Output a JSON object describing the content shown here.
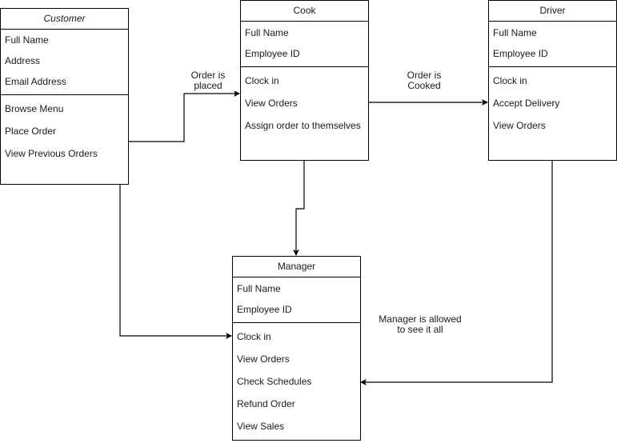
{
  "classes": {
    "customer": {
      "name": "Customer",
      "attributes": [
        "Full Name",
        "Address",
        "Email Address"
      ],
      "methods": [
        "Browse Menu",
        "Place Order",
        "View Previous Orders"
      ]
    },
    "cook": {
      "name": "Cook",
      "attributes": [
        "Full Name",
        "Employee ID"
      ],
      "methods": [
        "Clock in",
        "View Orders",
        "Assign order to themselves"
      ]
    },
    "driver": {
      "name": "Driver",
      "attributes": [
        "Full Name",
        "Employee ID"
      ],
      "methods": [
        "Clock in",
        "Accept Delivery",
        "View Orders"
      ]
    },
    "manager": {
      "name": "Manager",
      "attributes": [
        "Full Name",
        "Employee ID"
      ],
      "methods": [
        "Clock in",
        "View Orders",
        "Check Schedules",
        "Refund Order",
        "View Sales"
      ]
    }
  },
  "connectors": [
    {
      "from": "Customer",
      "to": "Cook",
      "label_line1": "Order is",
      "label_line2": "placed"
    },
    {
      "from": "Cook",
      "to": "Driver",
      "label_line1": "Order is",
      "label_line2": "Cooked"
    },
    {
      "from": "Cook",
      "to": "Manager",
      "label_line1": "",
      "label_line2": ""
    },
    {
      "from": "Customer",
      "to": "Manager",
      "label_line1": "",
      "label_line2": ""
    },
    {
      "from": "Driver",
      "to": "Manager",
      "label_line1": "",
      "label_line2": ""
    }
  ],
  "notes": {
    "manager_note_line1": "Manager is allowed",
    "manager_note_line2": "to see it all"
  },
  "colors": {
    "stroke": "#000000",
    "background": "#ffffff",
    "text": "#1a1a1a"
  }
}
